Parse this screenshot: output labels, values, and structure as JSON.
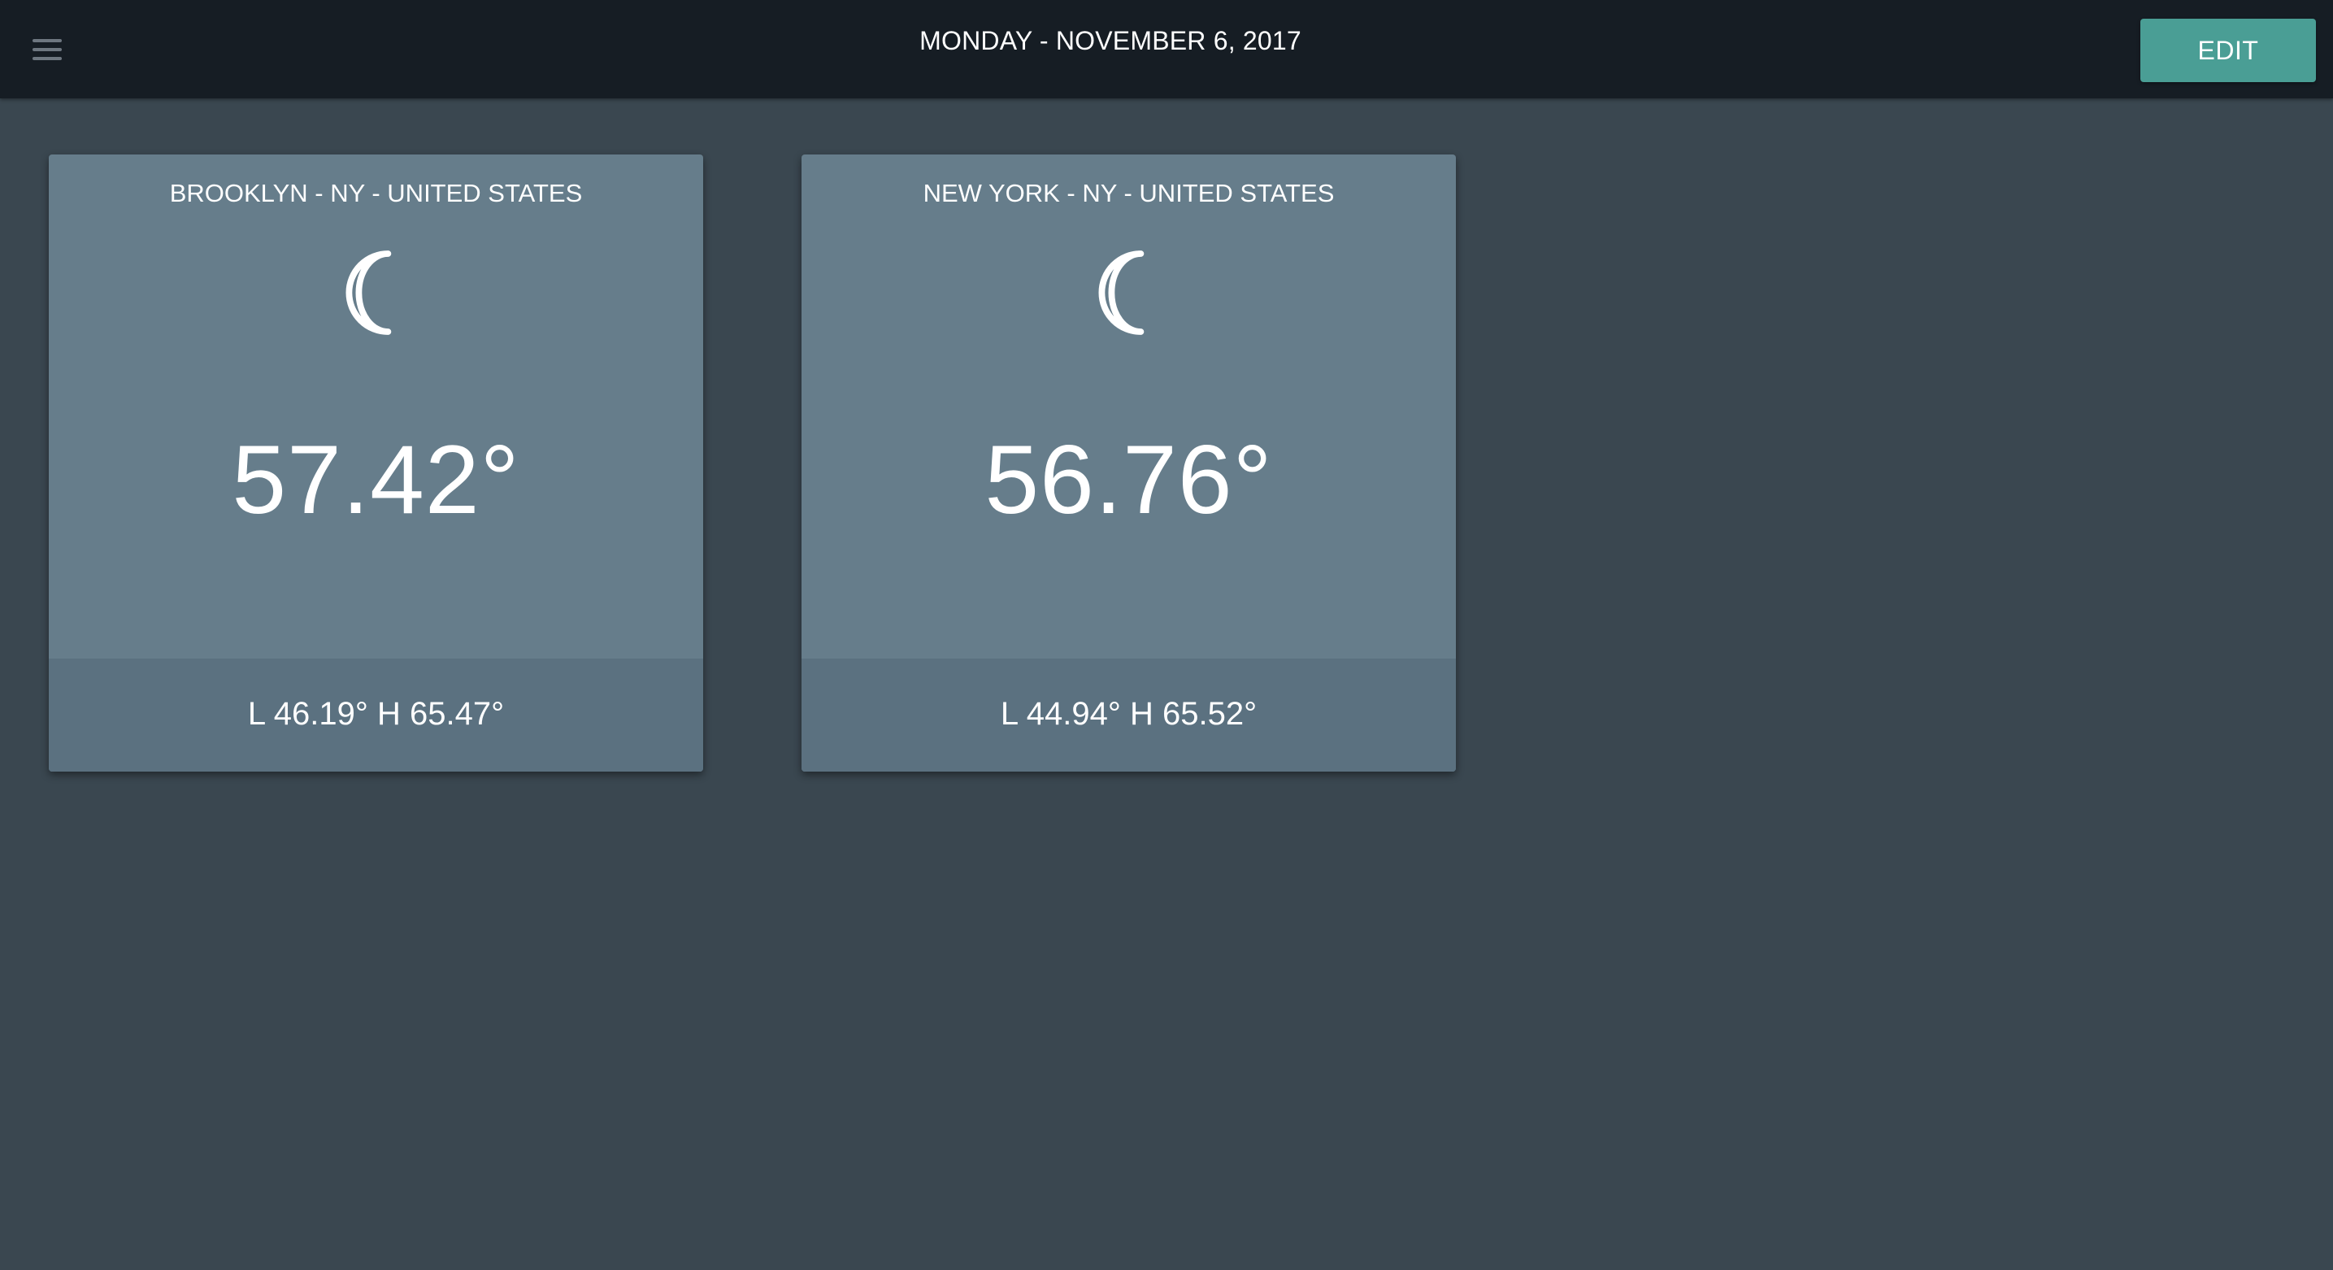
{
  "header": {
    "menu_icon": "hamburger-menu-icon",
    "date": "MONDAY - NOVEMBER 6, 2017",
    "edit_label": "EDIT",
    "accent_color": "#4a9e95"
  },
  "cards": [
    {
      "location": "BROOKLYN - NY - UNITED STATES",
      "icon": "moon-icon",
      "temperature": "57.42°",
      "range": "L 46.19° H 65.47°"
    },
    {
      "location": "NEW YORK - NY - UNITED STATES",
      "icon": "moon-icon",
      "temperature": "56.76°",
      "range": "L 44.94° H 65.52°"
    }
  ]
}
